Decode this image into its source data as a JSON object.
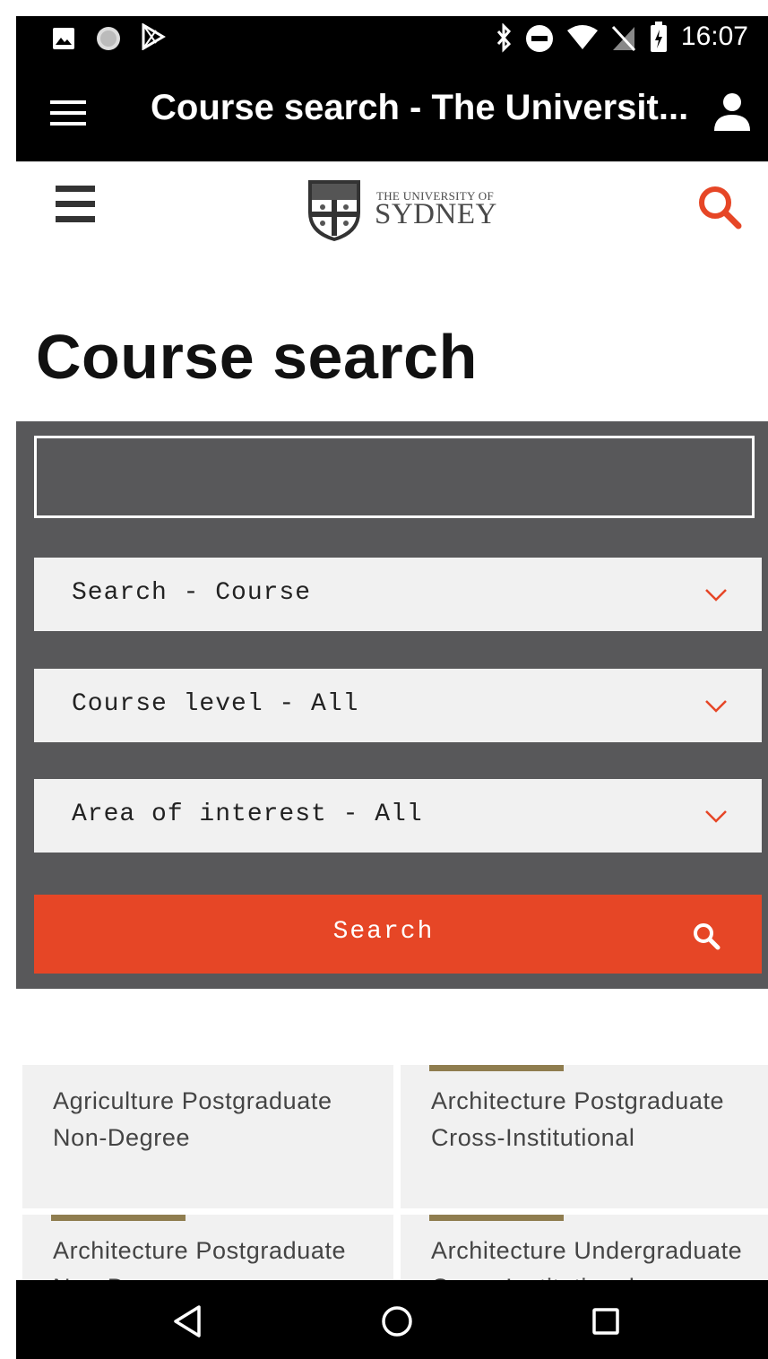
{
  "status_bar": {
    "time": "16:07"
  },
  "app_bar": {
    "title": "Course search - The Universit..."
  },
  "site_header": {
    "logo_top": "THE UNIVERSITY OF",
    "logo_main": "SYDNEY"
  },
  "page": {
    "title": "Course search"
  },
  "search_form": {
    "keyword_value": "",
    "search_type": "Search - Course",
    "course_level": "Course level - All",
    "area_of_interest": "Area of interest - All",
    "submit_label": "Search"
  },
  "results": [
    {
      "text": "Agriculture Postgraduate Non-Degree"
    },
    {
      "text": "Architecture Postgraduate Cross-Institutional"
    },
    {
      "text": "Architecture Postgraduate Non-Degree"
    },
    {
      "text": "Architecture Undergraduate Cross-Institutional"
    }
  ],
  "colors": {
    "accent": "#e64626",
    "gold": "#8f7d4f",
    "panel": "#58585a",
    "card": "#f1f1f1"
  }
}
